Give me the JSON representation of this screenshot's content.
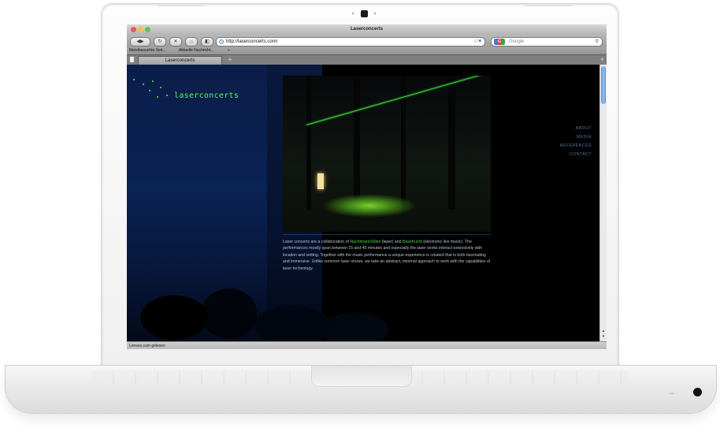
{
  "browser": {
    "window_title": "Laserconcerts",
    "url": "http://laserconcerts.com/",
    "search_placeholder": "Google",
    "bookmarks": [
      "Meistbesuchte Seit...",
      "Aktuelle Nachricht...",
      "»"
    ],
    "tab_title": "Laserconcerts",
    "tab_add": "+",
    "status_text": "Lenses.com gelesen",
    "icons": {
      "back": "back-icon",
      "forward": "forward-icon",
      "reload": "reload-icon",
      "stop": "stop-icon",
      "home": "home-icon",
      "search": "search-icon",
      "star": "star-icon"
    },
    "traffic_colors": [
      "#ee5a52",
      "#f4bf4f",
      "#5fc454"
    ]
  },
  "site": {
    "logo_text": "laserconcerts",
    "nav": [
      "ABOUT",
      "MEDIA",
      "REFERENCES",
      "CONTACT"
    ],
    "description": {
      "before_link1": "Laser concerts are a collaboration of ",
      "link1": "NachtmannSilies",
      "between": " (laser) and ",
      "link2": "Basefrucht",
      "after": " (electronic live music). The performances mostly span between 15 and 45 minutes and especially the laser works interact extensively with location and setting. Together with the music performance a unique experience is created that is both fascinating and immersive. Unlike common laser shows, we take an abstract, minimal approach to work with the capabilities of laser technology."
    },
    "accent_color": "#4dff4d"
  }
}
